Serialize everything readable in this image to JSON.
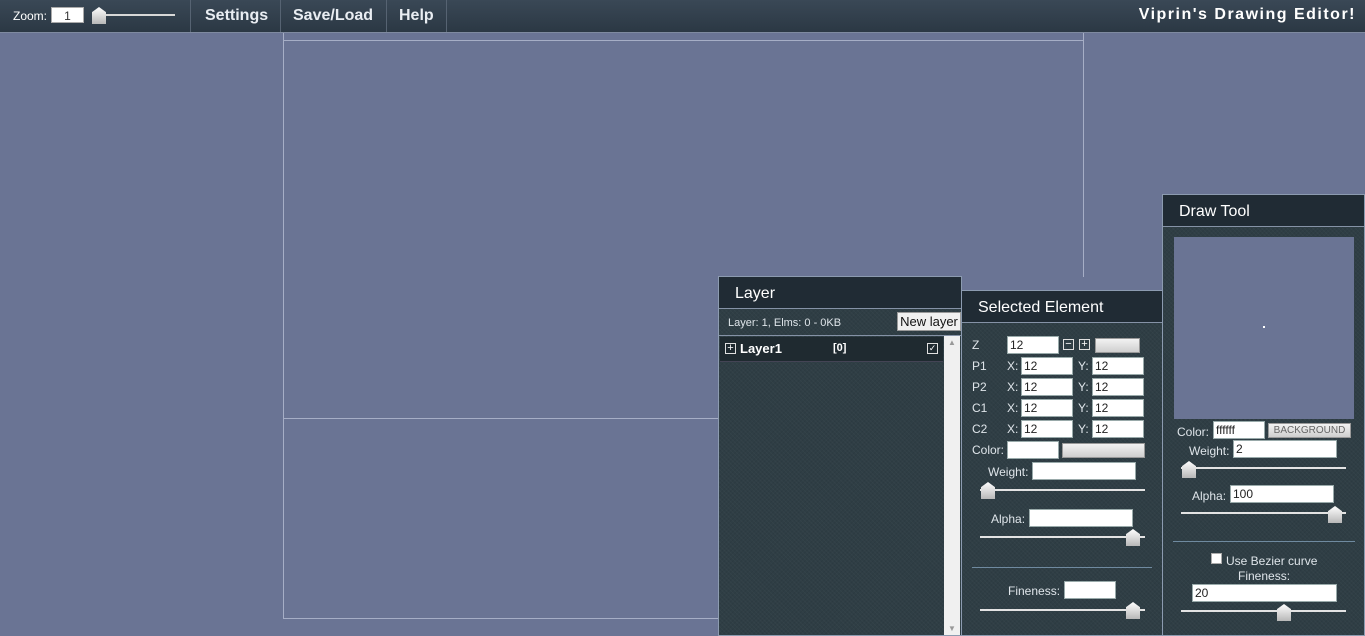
{
  "topbar": {
    "zoom_label": "Zoom:",
    "zoom_value": "1",
    "menu": [
      "Settings",
      "Save/Load",
      "Help"
    ],
    "title": "Viprin's Drawing Editor!"
  },
  "layer_panel": {
    "title": "Layer",
    "info": "Layer: 1, Elms: 0 - 0KB",
    "new_layer_label": "New layer",
    "layers": [
      {
        "name": "Layer1",
        "count": "[0]",
        "visible": true
      }
    ]
  },
  "selected_element": {
    "title": "Selected Element",
    "z_label": "Z",
    "z_value": "12",
    "rows": [
      {
        "label": "P1",
        "x": "12",
        "y": "12"
      },
      {
        "label": "P2",
        "x": "12",
        "y": "12"
      },
      {
        "label": "C1",
        "x": "12",
        "y": "12"
      },
      {
        "label": "C2",
        "x": "12",
        "y": "12"
      }
    ],
    "x_label": "X:",
    "y_label": "Y:",
    "color_label": "Color:",
    "color_value": "",
    "weight_label": "Weight:",
    "weight_value": "",
    "alpha_label": "Alpha:",
    "alpha_value": "",
    "fineness_label": "Fineness:",
    "fineness_value": ""
  },
  "draw_tool": {
    "title": "Draw Tool",
    "color_label": "Color:",
    "color_value": "ffffff",
    "background_label": "BACKGROUND",
    "weight_label": "Weight:",
    "weight_value": "2",
    "alpha_label": "Alpha:",
    "alpha_value": "100",
    "bezier_label": "Use Bezier curve",
    "bezier_checked": false,
    "fineness_label": "Fineness:",
    "fineness_value": "20"
  },
  "colors": {
    "canvas_bg": "#6a7494",
    "panel_bg": "#2f3e45",
    "header_bg": "#202b34",
    "topbar_bg": "#2b3844"
  }
}
